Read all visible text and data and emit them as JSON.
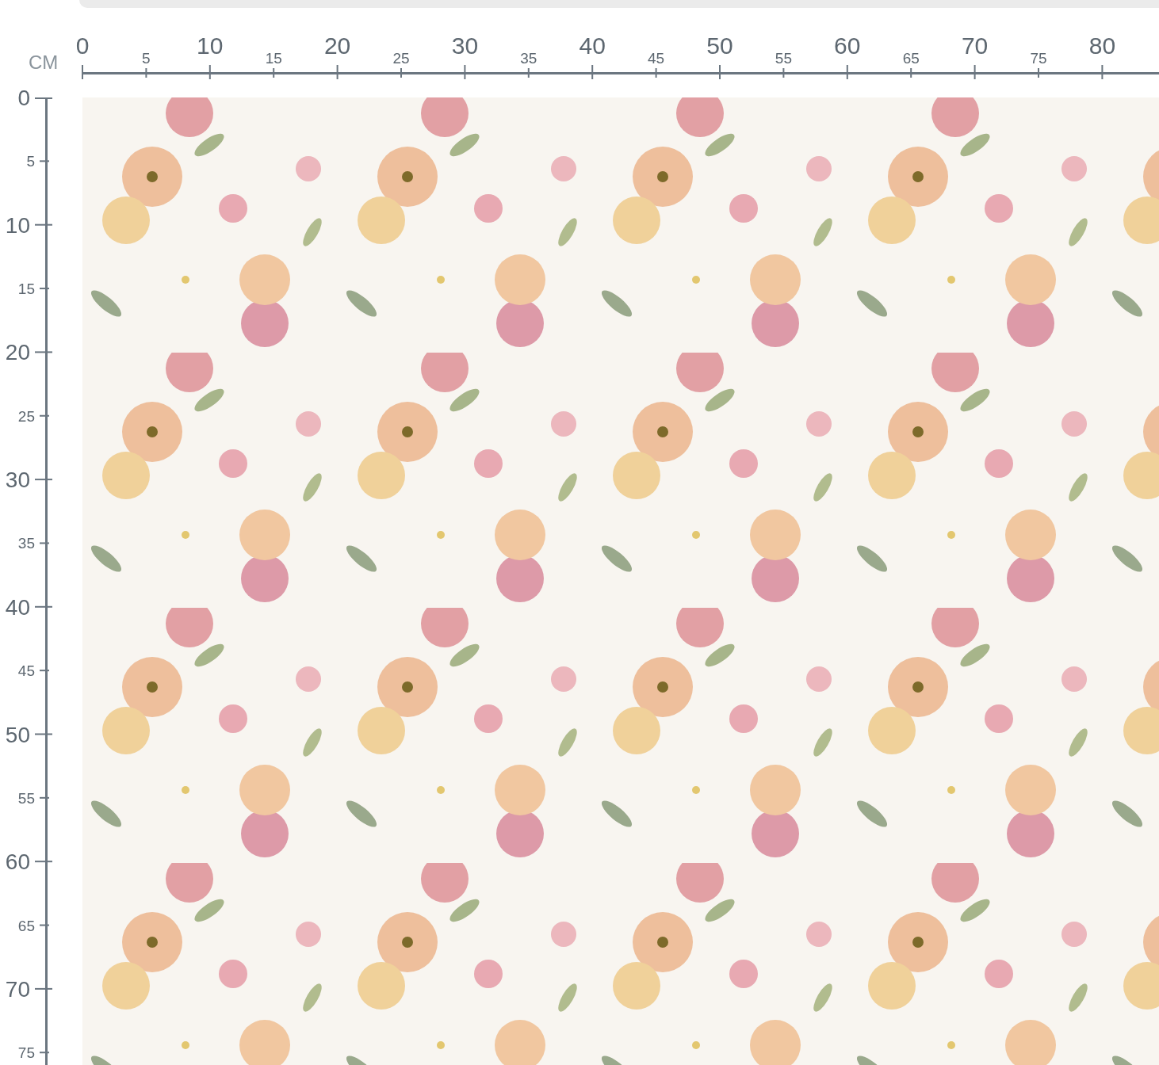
{
  "unit": "CM",
  "top_ruler": {
    "labels": [
      "0",
      "5",
      "10",
      "15",
      "20",
      "25",
      "30",
      "35",
      "40",
      "45",
      "50",
      "55",
      "60",
      "65",
      "70",
      "75",
      "80"
    ]
  },
  "left_ruler": {
    "labels": [
      "0",
      "5",
      "10",
      "15",
      "20",
      "25",
      "30",
      "35",
      "40",
      "45",
      "50",
      "55",
      "60",
      "65",
      "70",
      "75"
    ]
  }
}
